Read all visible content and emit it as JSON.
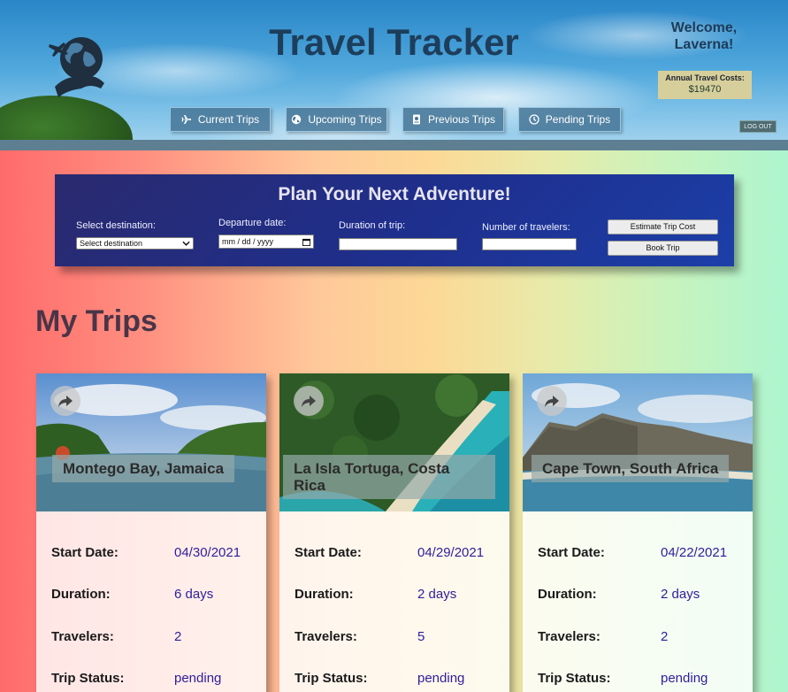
{
  "app": {
    "title": "Travel Tracker",
    "welcome": "Welcome, Laverna!",
    "costs_label": "Annual Travel Costs:",
    "costs_value": "$19470",
    "logout_label": "LOG OUT"
  },
  "nav": [
    {
      "label": "Current Trips",
      "icon": "airplane-icon"
    },
    {
      "label": "Upcoming Trips",
      "icon": "globe-icon"
    },
    {
      "label": "Previous Trips",
      "icon": "passport-icon"
    },
    {
      "label": "Pending Trips",
      "icon": "clock-icon"
    }
  ],
  "plan": {
    "title": "Plan Your Next Adventure!",
    "destination_label": "Select destination:",
    "destination_value": "Select destination",
    "date_label": "Departure date:",
    "date_placeholder": "mm / dd / yyyy",
    "duration_label": "Duration of trip:",
    "travelers_label": "Number of travelers:",
    "estimate_button": "Estimate Trip Cost",
    "book_button": "Book Trip"
  },
  "my_trips": {
    "heading": "My Trips",
    "labels": {
      "start": "Start Date:",
      "duration": "Duration:",
      "travelers": "Travelers:",
      "status": "Trip Status:"
    },
    "cards": [
      {
        "destination": "Montego Bay, Jamaica",
        "start": "04/30/2021",
        "duration": "6 days",
        "travelers": "2",
        "status": "pending"
      },
      {
        "destination": "La Isla Tortuga, Costa Rica",
        "start": "04/29/2021",
        "duration": "2 days",
        "travelers": "5",
        "status": "pending"
      },
      {
        "destination": "Cape Town, South Africa",
        "start": "04/22/2021",
        "duration": "2 days",
        "travelers": "2",
        "status": "pending"
      }
    ]
  },
  "colors": {
    "title": "#1d3e5b",
    "plan_panel": "#1e2f8e",
    "value_text": "#2f1d9b",
    "heading": "#4a3548"
  }
}
